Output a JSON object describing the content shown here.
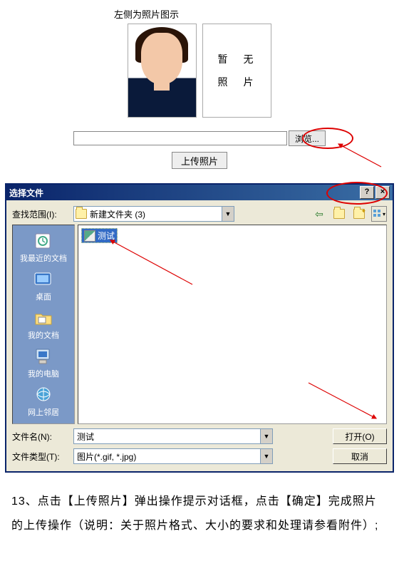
{
  "top": {
    "caption": "左侧为照片图示",
    "placeholder_line1": "暂　无",
    "placeholder_line2": "照　片",
    "browse_label": "浏览...",
    "upload_label": "上传照片"
  },
  "dialog": {
    "title": "选择文件",
    "help_btn": "?",
    "close_btn": "×",
    "lookin_label": "查找范围(I):",
    "lookin_value": "新建文件夹 (3)",
    "places": [
      {
        "label": "我最近的文档"
      },
      {
        "label": "桌面"
      },
      {
        "label": "我的文档"
      },
      {
        "label": "我的电脑"
      },
      {
        "label": "网上邻居"
      }
    ],
    "file_item": "测试",
    "filename_label": "文件名(N):",
    "filename_value": "测试",
    "filetype_label": "文件类型(T):",
    "filetype_value": "图片(*.gif, *.jpg)",
    "open_label": "打开(O)",
    "cancel_label": "取消"
  },
  "instruction": "13、点击【上传照片】弹出操作提示对话框，点击【确定】完成照片的上传操作（说明：关于照片格式、大小的要求和处理请参看附件）;"
}
